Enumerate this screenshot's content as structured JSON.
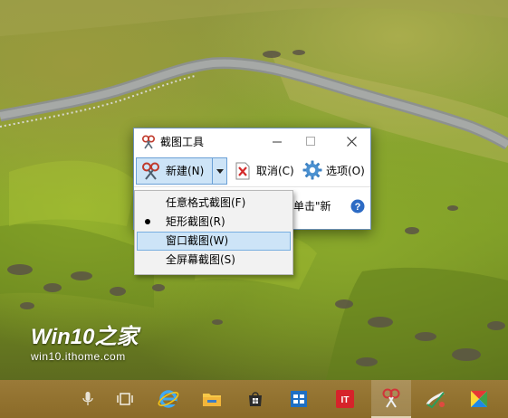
{
  "watermark": {
    "title": "Win10之家",
    "subtitle": "win10.ithome.com"
  },
  "snipping_tool": {
    "title": "截图工具",
    "toolbar": {
      "new_label": "新建(N)",
      "cancel_label": "取消(C)",
      "options_label": "选项(O)"
    },
    "hint_text": "单击\"新"
  },
  "dropdown_menu": {
    "items": [
      {
        "label": "任意格式截图(F)"
      },
      {
        "label": "矩形截图(R)",
        "selected": true
      },
      {
        "label": "窗口截图(W)",
        "highlighted": true
      },
      {
        "label": "全屏幕截图(S)"
      }
    ]
  },
  "taskbar": {
    "items": [
      {
        "icon": "microphone-icon"
      },
      {
        "icon": "task-view-icon"
      },
      {
        "icon": "internet-explorer-icon"
      },
      {
        "icon": "file-explorer-icon"
      },
      {
        "icon": "store-icon"
      },
      {
        "icon": "outlook-icon"
      },
      {
        "icon": "ithome-icon"
      },
      {
        "icon": "snipping-tool-icon",
        "active": true
      },
      {
        "icon": "paint-icon"
      },
      {
        "icon": "colorful-app-icon"
      }
    ]
  },
  "colors": {
    "highlight": "#cde4f7",
    "highlight_border": "#78aee0",
    "taskbar": "#8f6f2c",
    "window_border": "#6b8fb8"
  }
}
